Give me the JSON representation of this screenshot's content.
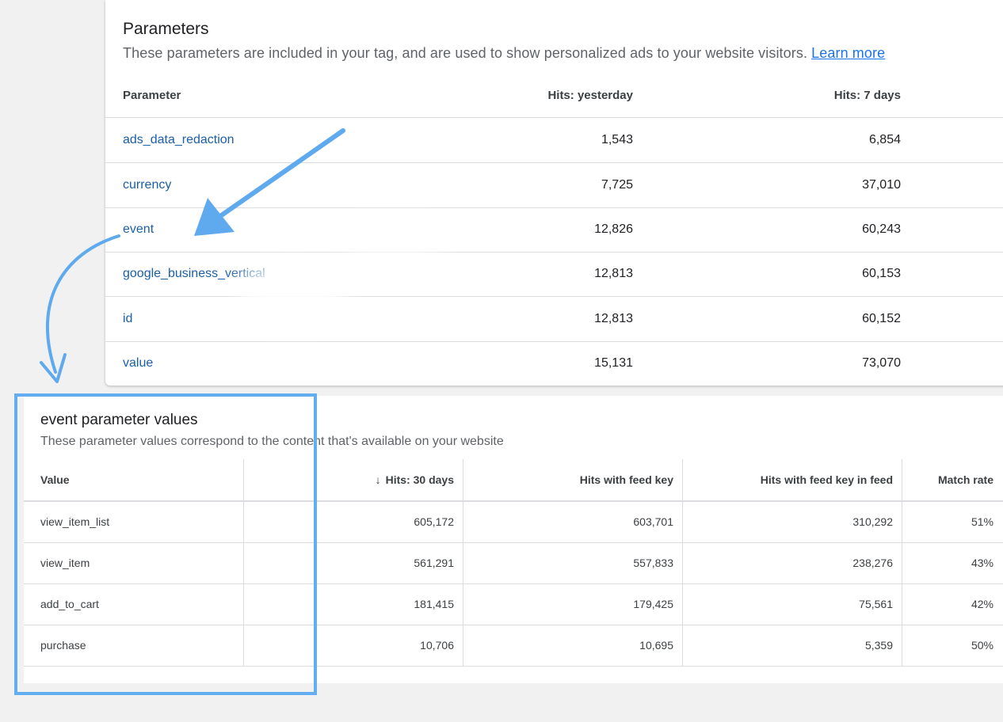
{
  "parameters_card": {
    "title": "Parameters",
    "subtitle": "These parameters are included in your tag, and are used to show personalized ads to your website visitors.",
    "learn_more": "Learn more",
    "headers": {
      "parameter": "Parameter",
      "hits_yesterday": "Hits: yesterday",
      "hits_7_days": "Hits: 7 days"
    },
    "rows": [
      {
        "name": "ads_data_redaction",
        "yesterday": "1,543",
        "week": "6,854"
      },
      {
        "name": "currency",
        "yesterday": "7,725",
        "week": "37,010"
      },
      {
        "name": "event",
        "yesterday": "12,826",
        "week": "60,243"
      },
      {
        "name": "google_business_vertical",
        "yesterday": "12,813",
        "week": "60,153"
      },
      {
        "name": "id",
        "yesterday": "12,813",
        "week": "60,152"
      },
      {
        "name": "value",
        "yesterday": "15,131",
        "week": "73,070"
      }
    ]
  },
  "event_values_card": {
    "title": "event parameter values",
    "subtitle": "These parameter values correspond to the content that's available on your website",
    "headers": {
      "value": "Value",
      "hits_30_days": "Hits: 30 days",
      "hits_with_feed_key": "Hits with feed key",
      "hits_with_feed_key_in_feed": "Hits with feed key in feed",
      "match_rate": "Match rate"
    },
    "sort_icon": "arrow-downward-icon",
    "rows": [
      {
        "value": "view_item_list",
        "hits30": "605,172",
        "feed_key": "603,701",
        "in_feed": "310,292",
        "match": "51%"
      },
      {
        "value": "view_item",
        "hits30": "561,291",
        "feed_key": "557,833",
        "in_feed": "238,276",
        "match": "43%"
      },
      {
        "value": "add_to_cart",
        "hits30": "181,415",
        "feed_key": "179,425",
        "in_feed": "75,561",
        "match": "42%"
      },
      {
        "value": "purchase",
        "hits30": "10,706",
        "feed_key": "10,695",
        "in_feed": "5,359",
        "match": "50%"
      }
    ]
  },
  "annotation": {
    "highlight_color": "#63aef0",
    "arrow_color": "#5fa9ee"
  }
}
